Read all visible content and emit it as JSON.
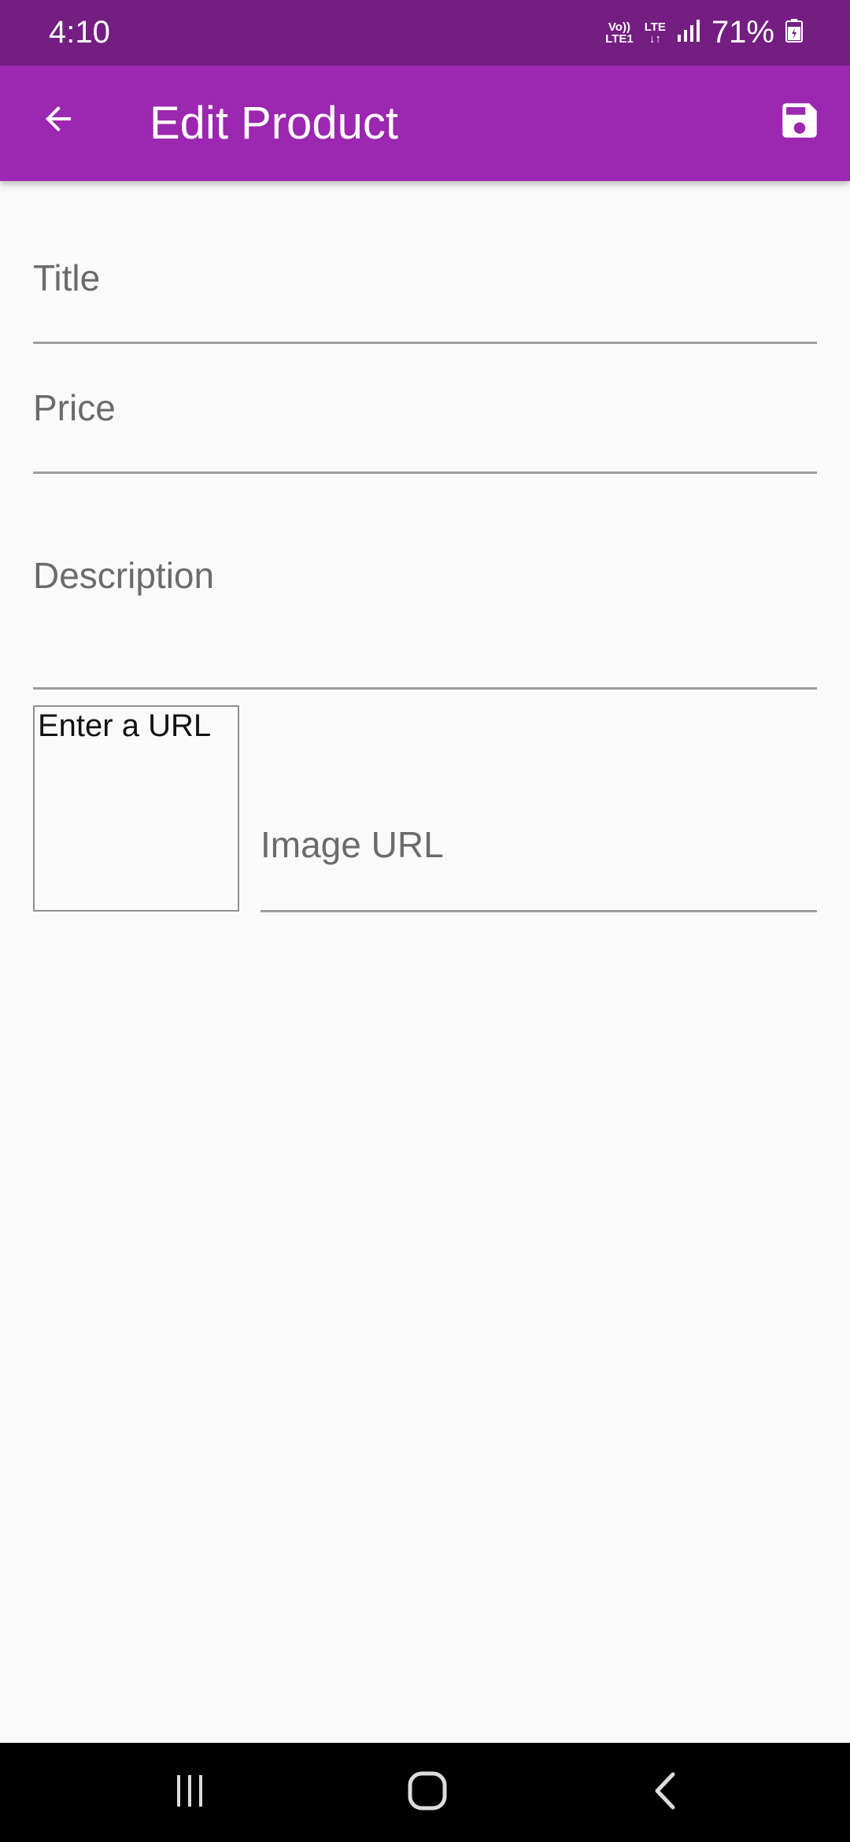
{
  "status_bar": {
    "time": "4:10",
    "volte_top": "Vo))",
    "volte_bottom": "LTE1",
    "lte_top": "LTE",
    "lte_arrows": "↓↑",
    "battery_percent": "71%",
    "battery_level": 0.71
  },
  "app_bar": {
    "title": "Edit Product",
    "back_icon": "arrow-back-icon",
    "save_icon": "save-icon",
    "background": "#9c27b0",
    "status_background": "#741e82"
  },
  "form": {
    "title_label": "Title",
    "price_label": "Price",
    "description_label": "Description",
    "image_preview_text": "Enter a URL",
    "image_url_label": "Image URL"
  },
  "nav_bar": {
    "recents_icon": "recents-icon",
    "home_icon": "home-icon",
    "back_icon": "back-chevron-icon"
  }
}
